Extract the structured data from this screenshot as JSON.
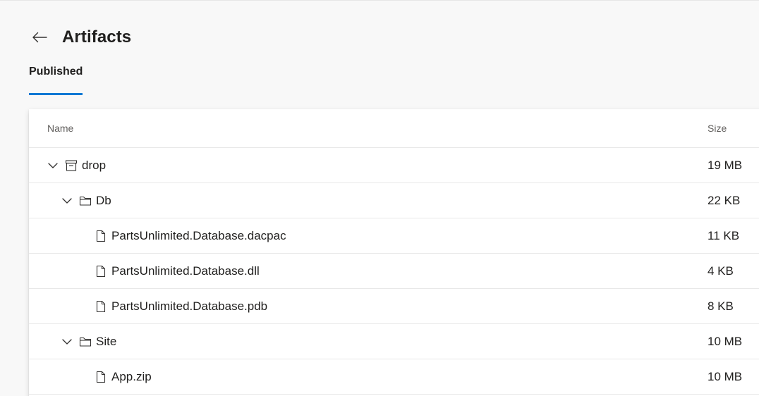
{
  "header": {
    "title": "Artifacts",
    "back_icon": "arrow-left-icon"
  },
  "tabs": [
    {
      "label": "Published",
      "active": true
    }
  ],
  "table": {
    "columns": {
      "name": "Name",
      "size": "Size"
    },
    "rows": [
      {
        "name": "drop",
        "size": "19 MB",
        "type": "artifact",
        "icon": "artifact-box-icon",
        "expanded": true,
        "level": 0
      },
      {
        "name": "Db",
        "size": "22 KB",
        "type": "folder",
        "icon": "folder-icon",
        "expanded": true,
        "level": 1
      },
      {
        "name": "PartsUnlimited.Database.dacpac",
        "size": "11 KB",
        "type": "file",
        "icon": "file-icon",
        "level": 2
      },
      {
        "name": "PartsUnlimited.Database.dll",
        "size": "4 KB",
        "type": "file",
        "icon": "file-icon",
        "level": 2
      },
      {
        "name": "PartsUnlimited.Database.pdb",
        "size": "8 KB",
        "type": "file",
        "icon": "file-icon",
        "level": 2
      },
      {
        "name": "Site",
        "size": "10 MB",
        "type": "folder",
        "icon": "folder-icon",
        "expanded": true,
        "level": 1
      },
      {
        "name": "App.zip",
        "size": "10 MB",
        "type": "file",
        "icon": "file-icon",
        "level": 2
      }
    ]
  },
  "colors": {
    "accent": "#0078d4",
    "background": "#f8f8f8",
    "card": "#ffffff",
    "text": "#201f1e",
    "muted": "#605e5c"
  }
}
